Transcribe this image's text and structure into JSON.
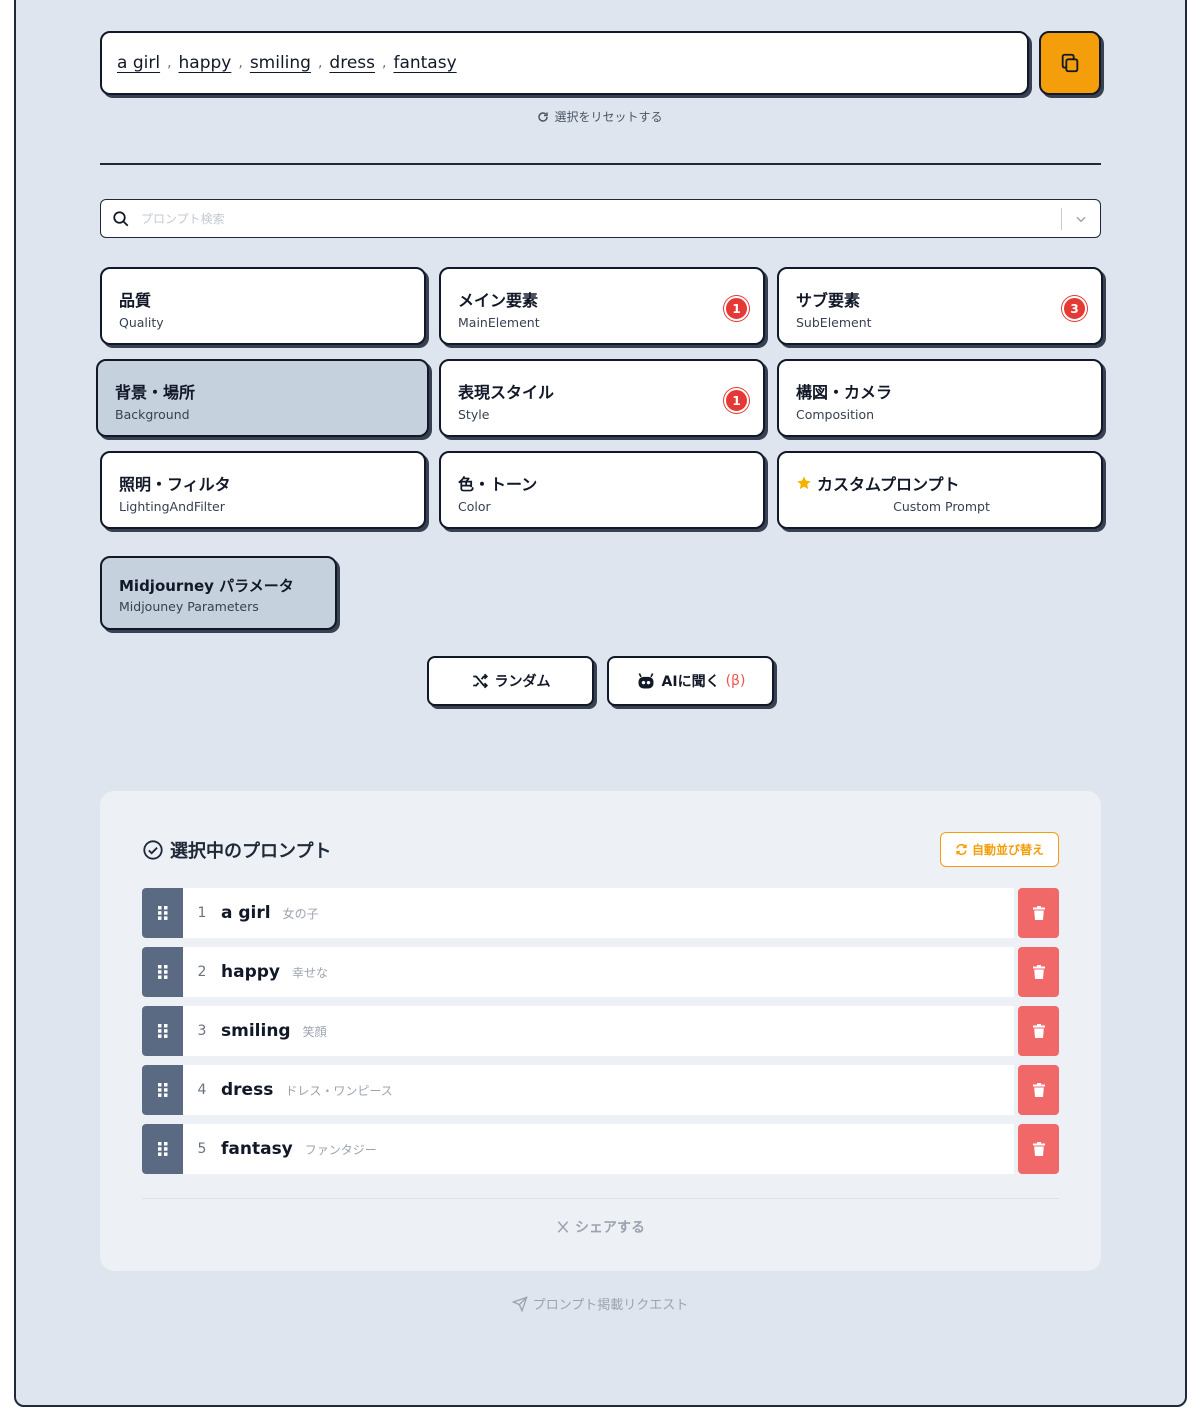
{
  "prompt_output": {
    "tokens": [
      "a girl",
      "happy",
      "smiling",
      "dress",
      "fantasy"
    ],
    "separator": ","
  },
  "icons": {
    "copy": "copy-icon",
    "reset": "refresh-icon",
    "search": "search-icon",
    "dropdown": "chevron-down-icon"
  },
  "reset_label": "選択をリセットする",
  "search": {
    "placeholder": "プロンプト検索"
  },
  "categories": [
    {
      "jp": "品質",
      "en": "Quality",
      "badge": null,
      "selected": false
    },
    {
      "jp": "メイン要素",
      "en": "MainElement",
      "badge": "1",
      "selected": false
    },
    {
      "jp": "サブ要素",
      "en": "SubElement",
      "badge": "3",
      "selected": false
    },
    {
      "jp": "背景・場所",
      "en": "Background",
      "badge": null,
      "selected": true
    },
    {
      "jp": "表現スタイル",
      "en": "Style",
      "badge": "1",
      "selected": false
    },
    {
      "jp": "構図・カメラ",
      "en": "Composition",
      "badge": null,
      "selected": false
    },
    {
      "jp": "照明・フィルタ",
      "en": "LightingAndFilter",
      "badge": null,
      "selected": false
    },
    {
      "jp": "色・トーン",
      "en": "Color",
      "badge": null,
      "selected": false
    },
    {
      "jp": "カスタムプロンプト",
      "en": "Custom Prompt",
      "badge": null,
      "selected": false
    }
  ],
  "midjourney": {
    "jp": "Midjourney パラメータ",
    "en": "Midjouney Parameters"
  },
  "actions": {
    "random": "ランダム",
    "ask_ai": "AIに聞く",
    "beta": "(β)"
  },
  "selected_panel": {
    "title": "選択中のプロンプト",
    "sort_label": "自動並び替え",
    "items": [
      {
        "num": "1",
        "word": "a girl",
        "translation": "女の子"
      },
      {
        "num": "2",
        "word": "happy",
        "translation": "幸せな"
      },
      {
        "num": "3",
        "word": "smiling",
        "translation": "笑顔"
      },
      {
        "num": "4",
        "word": "dress",
        "translation": "ドレス・ワンピース"
      },
      {
        "num": "5",
        "word": "fantasy",
        "translation": "ファンタジー"
      }
    ],
    "share_label": "シェアする"
  },
  "request_label": "プロンプト掲載リクエスト",
  "colors": {
    "accent": "#f59e0b",
    "badge": "#e53935",
    "delete": "#f06868",
    "handle": "#5a6a82",
    "selected_card": "#c6d1de"
  }
}
